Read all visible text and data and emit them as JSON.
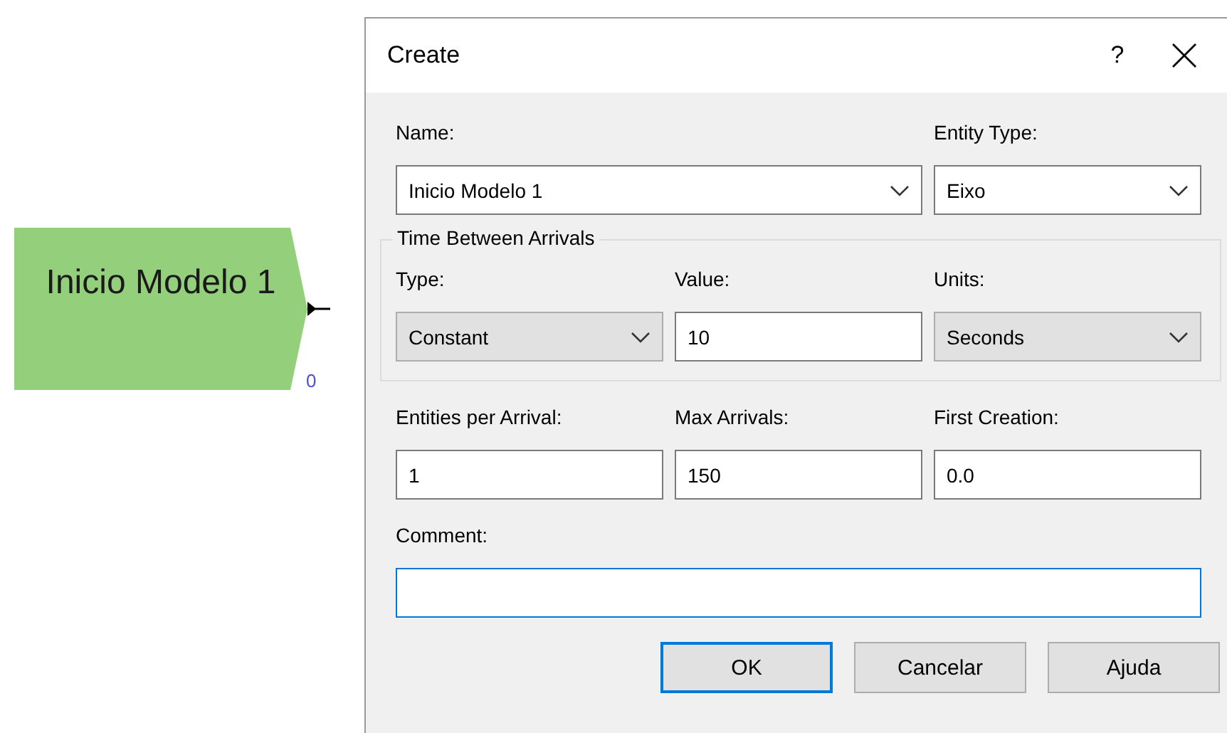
{
  "module": {
    "label": "Inicio Modelo 1",
    "counter": "0"
  },
  "dialog": {
    "title": "Create",
    "help": "?",
    "rows": [
      {
        "fields": [
          {
            "label": "Name:",
            "kind": "combo",
            "value": "Inicio Modelo 1"
          },
          {
            "label": "Entity Type:",
            "kind": "combo",
            "value": "Eixo"
          }
        ]
      }
    ],
    "group": {
      "title": "Time Between Arrivals",
      "fields": [
        {
          "label": "Type:",
          "kind": "dropdown",
          "value": "Constant"
        },
        {
          "label": "Value:",
          "kind": "text",
          "value": "10"
        },
        {
          "label": "Units:",
          "kind": "dropdown",
          "value": "Seconds"
        }
      ]
    },
    "rows2": [
      {
        "fields": [
          {
            "label": "Entities per Arrival:",
            "kind": "text",
            "value": "1"
          },
          {
            "label": "Max Arrivals:",
            "kind": "text",
            "value": "150"
          },
          {
            "label": "First Creation:",
            "kind": "text",
            "value": "0.0"
          }
        ]
      },
      {
        "fields": [
          {
            "label": "Comment:",
            "kind": "text",
            "focused": true
          }
        ]
      }
    ],
    "buttons": [
      {
        "label": "OK",
        "default": true
      },
      {
        "label": "Cancelar",
        "default": false
      },
      {
        "label": "Ajuda",
        "default": false
      }
    ]
  }
}
